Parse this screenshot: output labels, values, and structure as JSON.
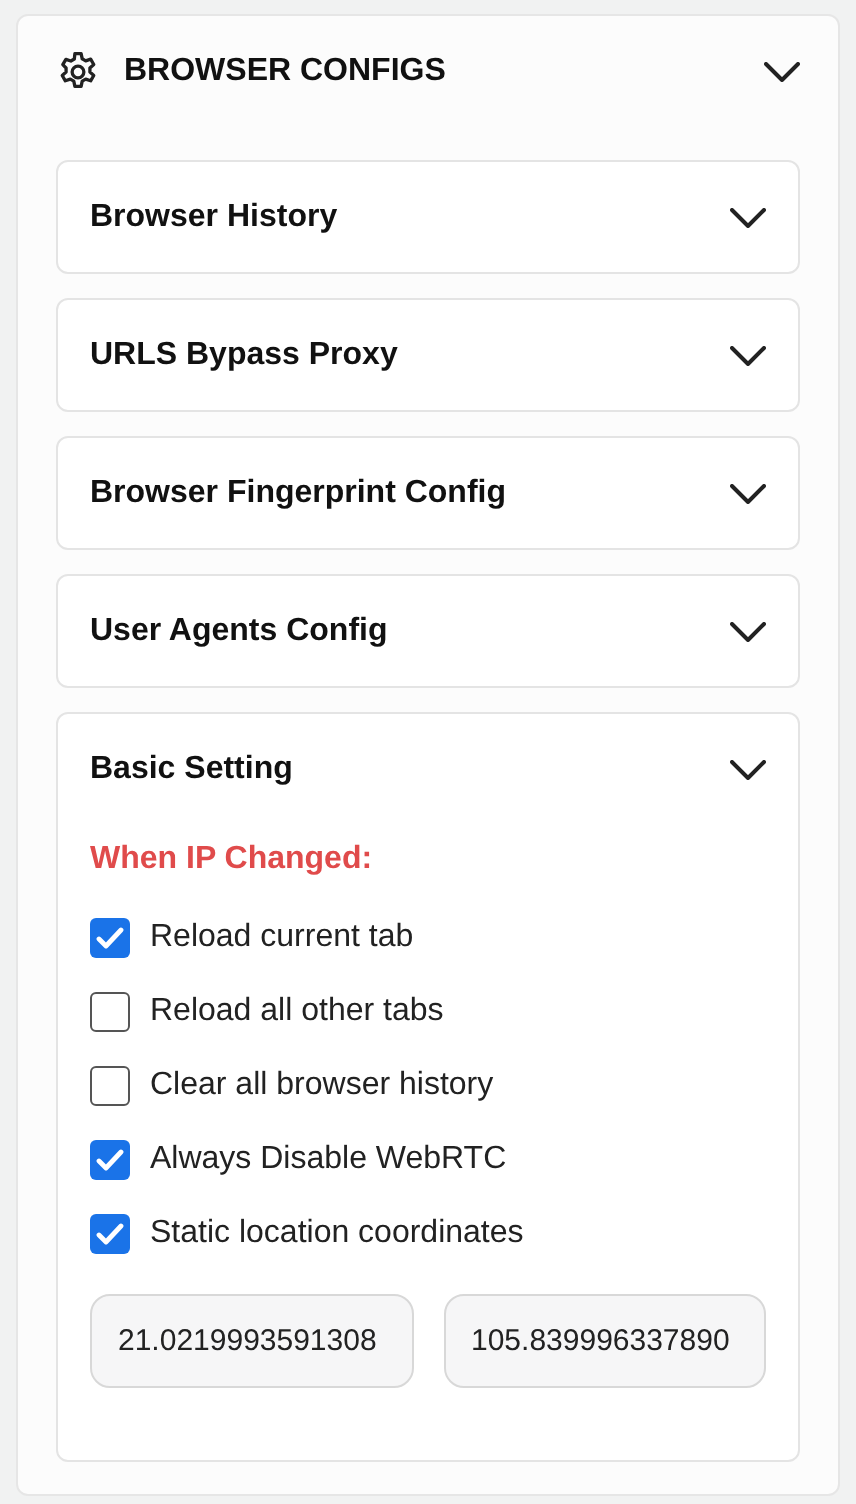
{
  "panel": {
    "title": "BROWSER CONFIGS",
    "expanded": true
  },
  "sections": [
    {
      "title": "Browser History",
      "expanded": false
    },
    {
      "title": "URLS Bypass Proxy",
      "expanded": false
    },
    {
      "title": "Browser Fingerprint Config",
      "expanded": false
    },
    {
      "title": "User Agents Config",
      "expanded": false
    },
    {
      "title": "Basic Setting",
      "expanded": true,
      "heading": "When IP Changed:",
      "options": [
        {
          "label": "Reload current tab",
          "checked": true
        },
        {
          "label": "Reload all other tabs",
          "checked": false
        },
        {
          "label": "Clear all browser history",
          "checked": false
        },
        {
          "label": "Always Disable WebRTC",
          "checked": true
        },
        {
          "label": "Static location coordinates",
          "checked": true
        }
      ],
      "coordinates": [
        {
          "value": "21.0219993591308"
        },
        {
          "value": "105.839996337890"
        }
      ]
    }
  ]
}
